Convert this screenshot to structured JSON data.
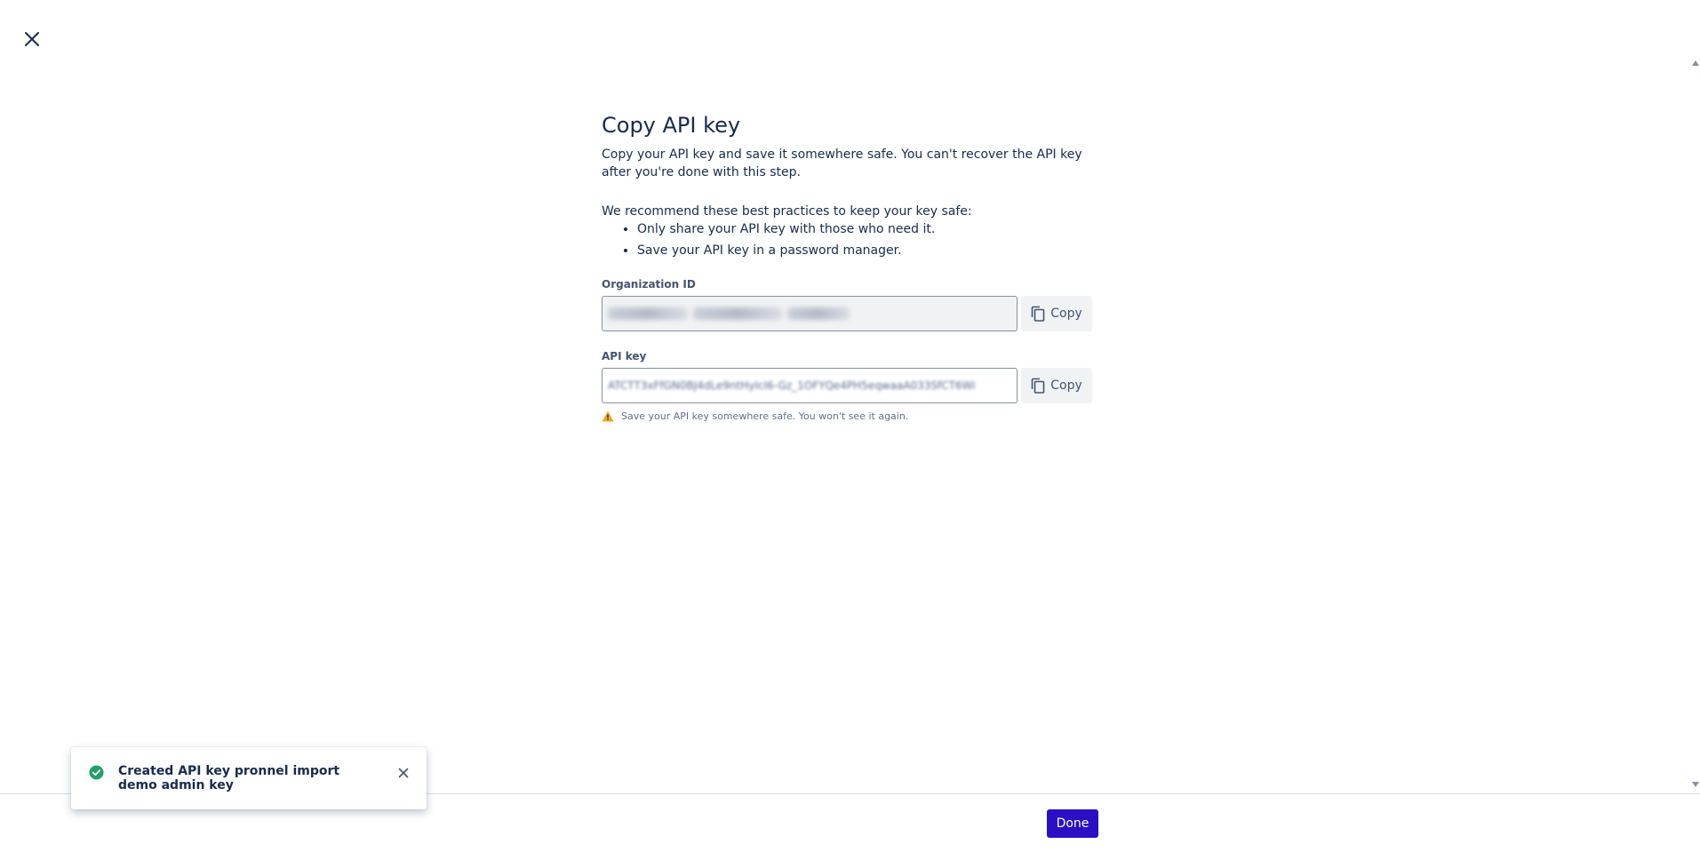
{
  "header": {
    "close_label": ""
  },
  "dialog": {
    "title": "Copy API key",
    "description": "Copy your API key and save it somewhere safe. You can't recover the API key after you're done with this step.",
    "best_practices_intro": "We recommend these best practices to keep your key safe:",
    "best_practices": [
      "Only share your API key with those who need it.",
      "Save your API key in a password manager."
    ],
    "org_field": {
      "label": "Organization ID",
      "copy_label": "Copy"
    },
    "key_field": {
      "label": "API key",
      "value": "ATCTT3xFfGN0BJ4dLe9ntHyIcI6-Gz_1OFYQe4PH5eqwaaA033SfCT6Wi",
      "copy_label": "Copy",
      "warning": "Save your API key somewhere safe. You won't see it again."
    }
  },
  "footer": {
    "done_label": "Done"
  },
  "toast": {
    "message": "Created API key pronnel import demo admin key"
  },
  "colors": {
    "primary": "#2a0fc4",
    "success": "#22a06b",
    "warning": "#f5a623",
    "text": "#172b4d"
  },
  "icons": {
    "close": "close-icon",
    "copy": "copy-icon",
    "warning": "warning-icon",
    "success": "check-circle-icon"
  }
}
